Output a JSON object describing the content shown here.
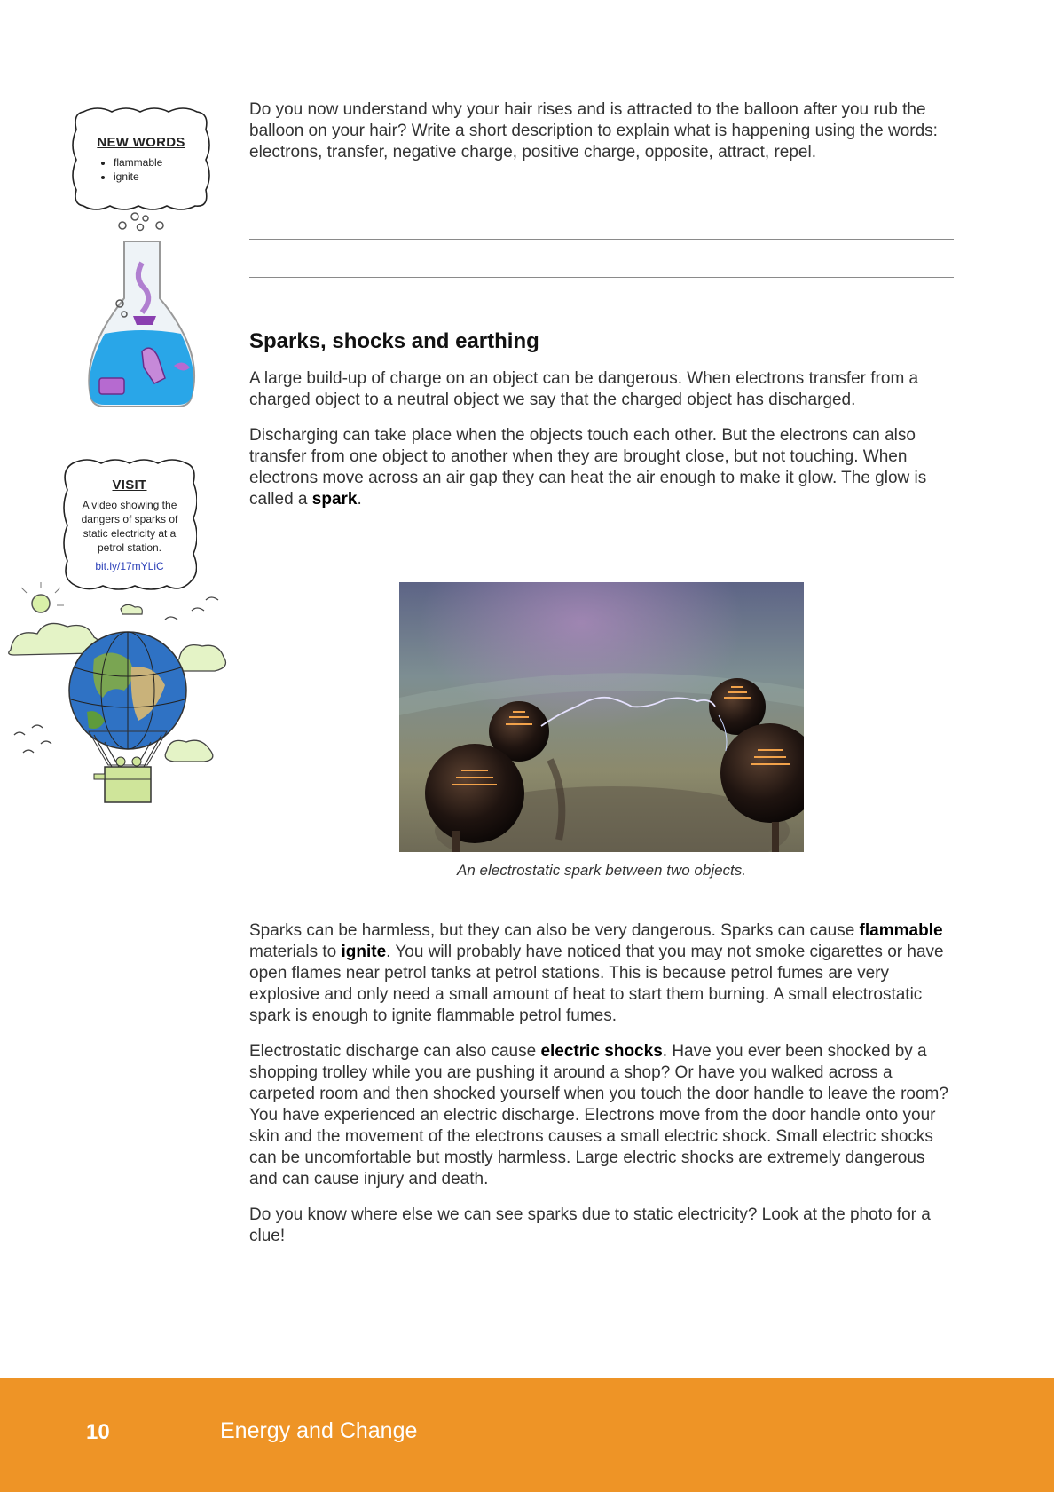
{
  "sidebar": {
    "new_words": {
      "heading": "NEW WORDS",
      "items": [
        "flammable",
        "ignite"
      ]
    },
    "visit": {
      "heading": "VISIT",
      "description": "A video showing the dangers of sparks of static electricity at a petrol station.",
      "link": "bit.ly/17mYLiC"
    }
  },
  "intro": {
    "question": "Do you now understand why your hair rises and is attracted to the balloon after you rub the balloon on your hair? Write a short description to explain what is happening using the words: electrons, transfer, negative charge, positive charge, opposite, attract, repel."
  },
  "section": {
    "heading": "Sparks, shocks and earthing",
    "para1": "A large build-up of charge on an object can be dangerous. When electrons transfer from a charged object to a neutral object we say that the charged object has discharged.",
    "para2_before": "Discharging can take place when the objects touch each other. But the electrons can also transfer from one object to another when they are brought close, but not touching. When electrons move across an air gap they can heat the air enough to make it glow. The glow is called a ",
    "para2_bold": "spark",
    "para2_after": "."
  },
  "figure": {
    "caption": "An electrostatic spark between two objects."
  },
  "lower": {
    "p1_a": "Sparks can be harmless, but they can also be very dangerous. Sparks can cause ",
    "p1_b": "flammable",
    "p1_c": " materials to ",
    "p1_d": "ignite",
    "p1_e": ". You will probably have noticed that you may not smoke cigarettes or have open flames near petrol tanks at petrol stations. This is because petrol fumes are very explosive and only need a small amount of heat to start them burning. A small electrostatic spark is enough to ignite flammable petrol fumes.",
    "p2_a": "Electrostatic discharge can also cause ",
    "p2_b": "electric shocks",
    "p2_c": ". Have you ever been shocked by a shopping trolley while you are pushing it around a shop? Or have you walked across a carpeted room and then shocked yourself when you touch the door handle to leave the room? You have experienced an electric discharge. Electrons move from the door handle onto your skin and the movement of the electrons causes a small electric shock. Small electric shocks can be uncomfortable but mostly harmless. Large electric shocks are extremely dangerous and can cause injury and death.",
    "p3": "Do you know where else we can see sparks due to static electricity? Look at the photo for a clue!"
  },
  "footer": {
    "page_number": "10",
    "title": "Energy and Change",
    "color": "#ee9426"
  }
}
